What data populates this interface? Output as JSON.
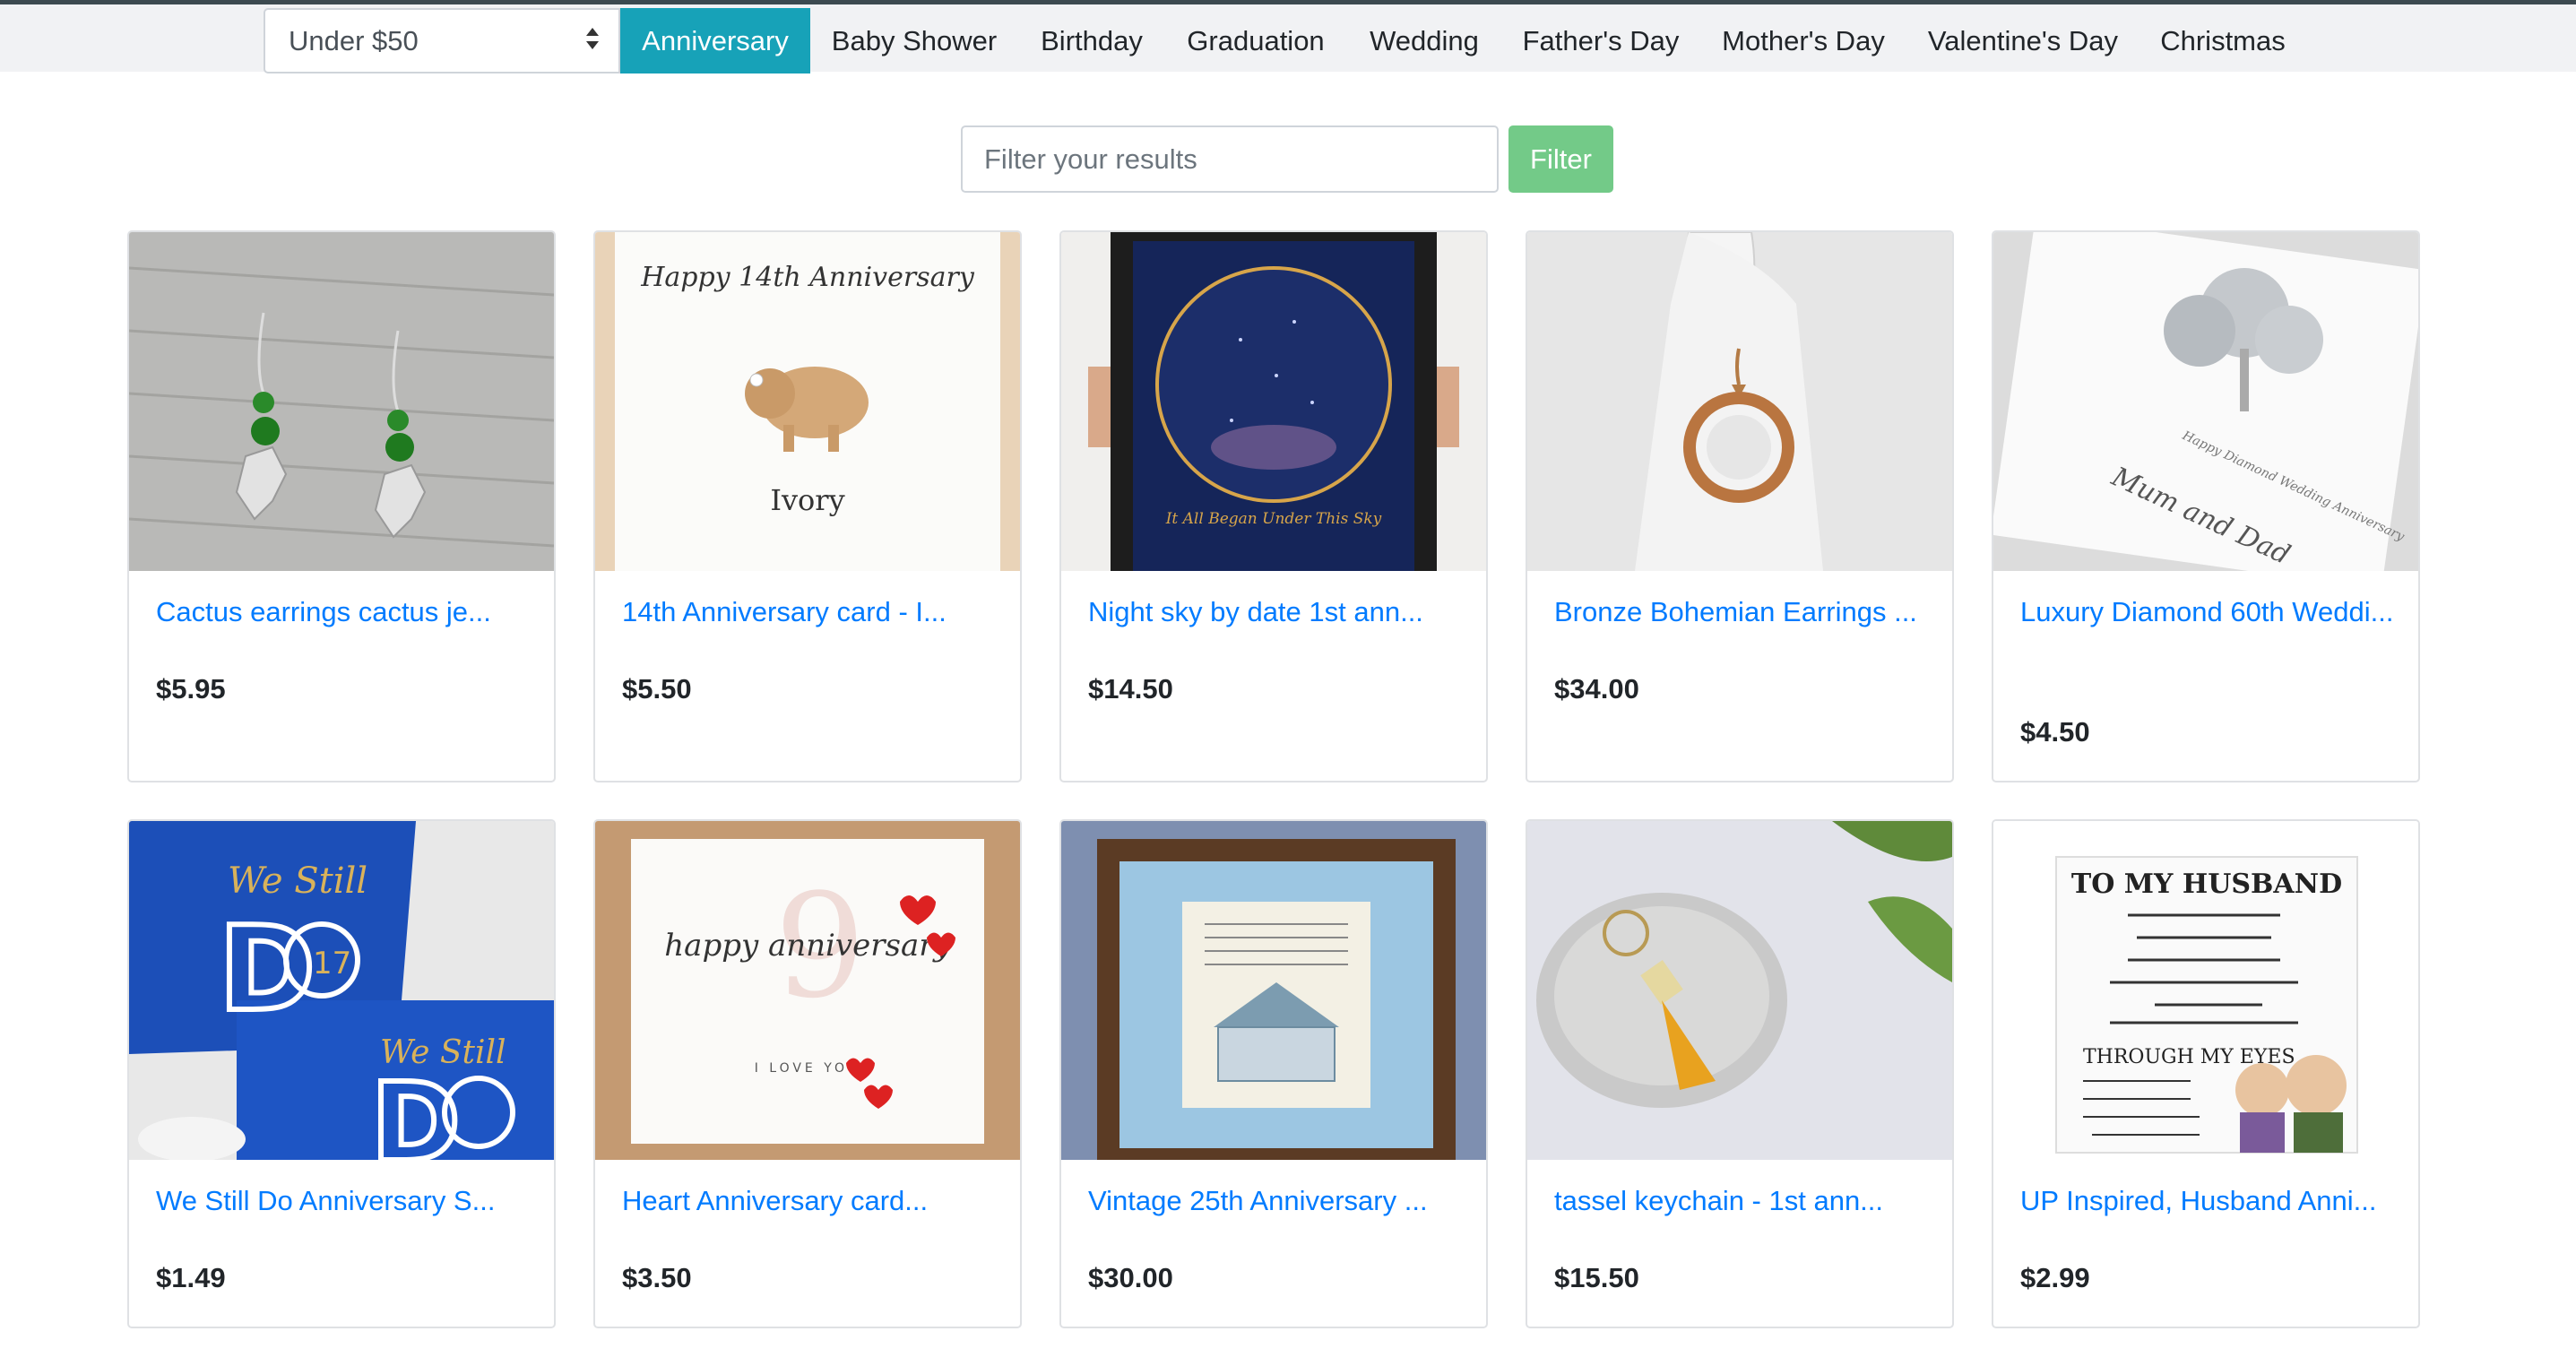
{
  "navbar": {
    "price_select": {
      "value": "Under $50"
    },
    "tabs": [
      {
        "label": "Anniversary",
        "active": true
      },
      {
        "label": "Baby Shower"
      },
      {
        "label": "Birthday"
      },
      {
        "label": "Graduation"
      },
      {
        "label": "Wedding"
      },
      {
        "label": "Father's Day"
      },
      {
        "label": "Mother's Day"
      },
      {
        "label": "Valentine's Day"
      },
      {
        "label": "Christmas"
      }
    ],
    "active_color": "#17a2b8"
  },
  "filter": {
    "placeholder": "Filter your results",
    "button_label": "Filter",
    "button_color": "#73ca88"
  },
  "products": [
    {
      "title": "Cactus earrings cactus je...",
      "price": "$5.95"
    },
    {
      "title": "14th Anniversary card - I...",
      "price": "$5.50",
      "image_text": {
        "line1": "Happy 14th Anniversary",
        "line2": "Ivory"
      }
    },
    {
      "title": "Night sky by date 1st ann...",
      "price": "$14.50",
      "image_text": {
        "line1": "It All Began Under This Sky"
      }
    },
    {
      "title": "Bronze Bohemian Earrings ...",
      "price": "$34.00"
    },
    {
      "title": "Luxury Diamond 60th Weddi...",
      "price": "$4.50",
      "image_text": {
        "line1": "Happy Diamond Wedding Anniversary",
        "line2": "Mum and Dad"
      }
    },
    {
      "title": "We Still Do Anniversary S...",
      "price": "$1.49",
      "image_text": {
        "line1": "We Still",
        "line2": "17"
      }
    },
    {
      "title": "Heart Anniversary card...",
      "price": "$3.50",
      "image_text": {
        "line1": "happy anniversary",
        "line2": "I LOVE YOU"
      }
    },
    {
      "title": "Vintage 25th Anniversary ...",
      "price": "$30.00"
    },
    {
      "title": "tassel keychain - 1st ann...",
      "price": "$15.50"
    },
    {
      "title": "UP Inspired, Husband Anni...",
      "price": "$2.99",
      "image_text": {
        "line1": "TO MY HUSBAND",
        "line2": "THROUGH MY EYES"
      }
    }
  ],
  "colors": {
    "link": "#007bff",
    "price": "#212529",
    "card_border": "#dfe1e4"
  }
}
